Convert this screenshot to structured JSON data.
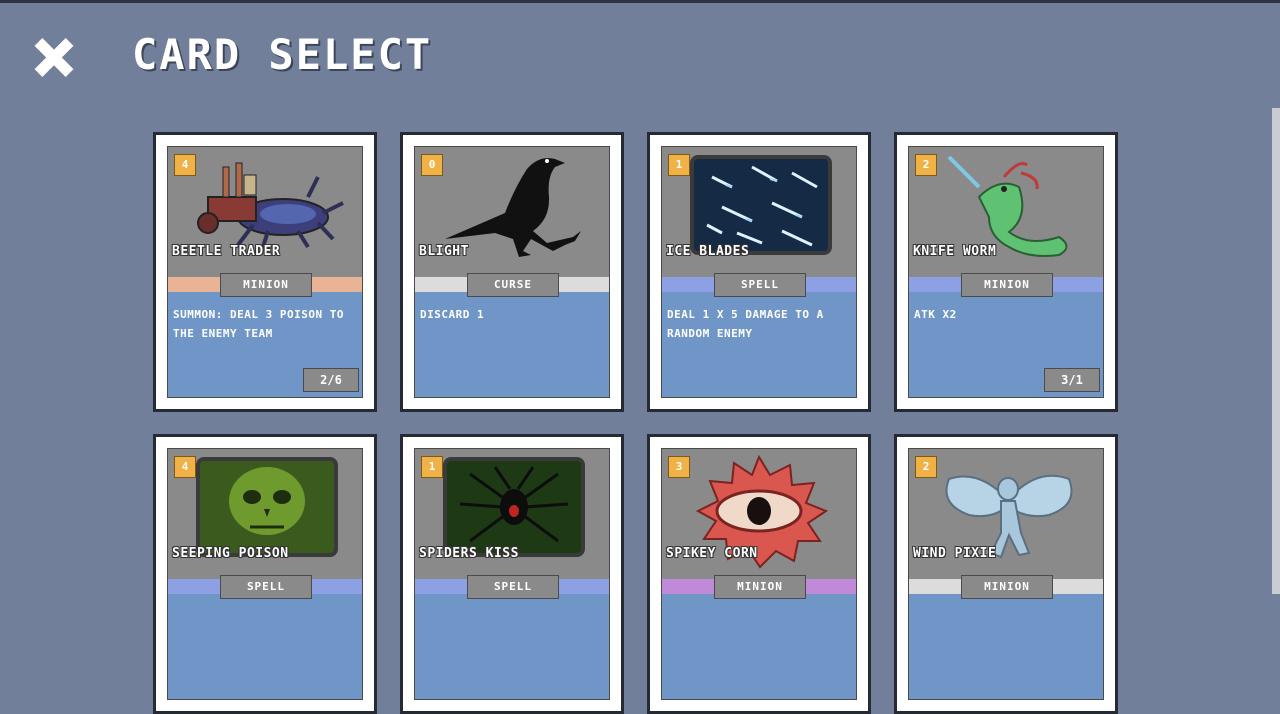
{
  "header": {
    "title": "CARD SELECT",
    "close_icon": "close-x-icon"
  },
  "colors": {
    "background": "#717f9b",
    "card_art_bg": "#8a8a8a",
    "card_text_bg": "#6f96c6",
    "cost_badge": "#f0b246",
    "minion_stripe_beetle": "#e9b496",
    "curse_stripe": "#dcdcdc",
    "spell_stripe": "#8ea0e4",
    "minion_stripe_knife": "#8ea0e4",
    "minion_stripe_spikey": "#c08ad9",
    "minion_stripe_pixie": "#dcdcdc"
  },
  "cards": [
    {
      "cost": "4",
      "name": "BEETLE TRADER",
      "type": "MINION",
      "description": "SUMMON: DEAL 3 POISON TO THE ENEMY TEAM",
      "stats": "2/6",
      "art": "beetle-cart-icon",
      "stripe": "#e9b496"
    },
    {
      "cost": "0",
      "name": "BLIGHT",
      "type": "CURSE",
      "description": "DISCARD 1",
      "stats": "",
      "art": "crow-silhouette-icon",
      "stripe": "#dcdcdc"
    },
    {
      "cost": "1",
      "name": "ICE BLADES",
      "type": "SPELL",
      "description": "DEAL 1 X 5 DAMAGE TO A RANDOM ENEMY",
      "stats": "",
      "art": "ice-shards-icon",
      "stripe": "#8ea0e4"
    },
    {
      "cost": "2",
      "name": "KNIFE WORM",
      "type": "MINION",
      "description": "ATK X2",
      "stats": "3/1",
      "art": "knife-worm-icon",
      "stripe": "#8ea0e4"
    },
    {
      "cost": "4",
      "name": "SEEPING POISON",
      "type": "SPELL",
      "description": "",
      "stats": "",
      "art": "poison-skull-icon",
      "stripe": "#8ea0e4"
    },
    {
      "cost": "1",
      "name": "SPIDERS KISS",
      "type": "SPELL",
      "description": "",
      "stats": "",
      "art": "spider-icon",
      "stripe": "#8ea0e4"
    },
    {
      "cost": "3",
      "name": "SPIKEY CORN",
      "type": "MINION",
      "description": "",
      "stats": "",
      "art": "spiky-eye-icon",
      "stripe": "#c08ad9"
    },
    {
      "cost": "2",
      "name": "WIND PIXIE",
      "type": "MINION",
      "description": "",
      "stats": "",
      "art": "pixie-icon",
      "stripe": "#dcdcdc"
    }
  ]
}
